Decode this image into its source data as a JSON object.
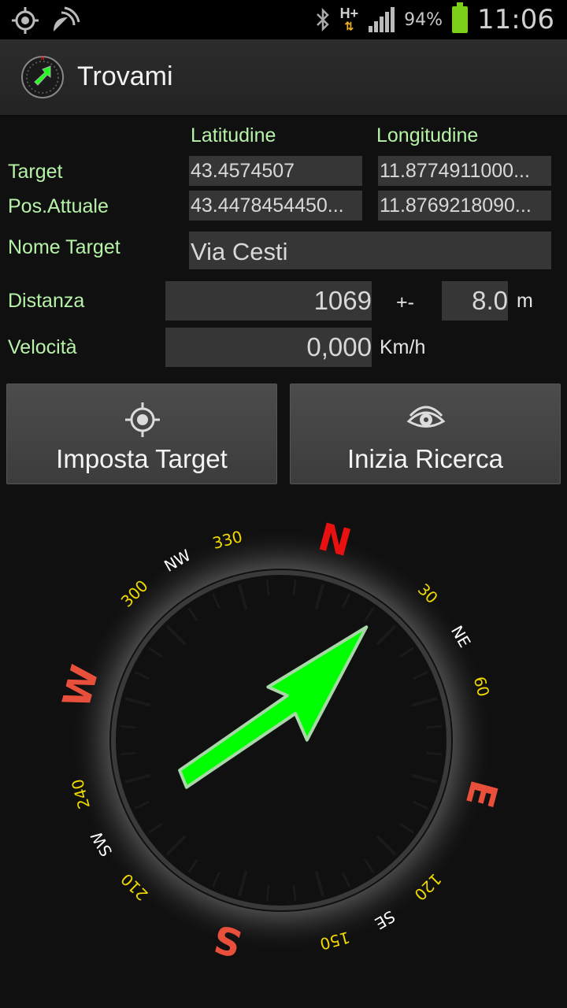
{
  "status_bar": {
    "battery_percent": "94%",
    "clock": "11:06",
    "network": "H+",
    "icons": [
      "gps-icon",
      "satellite-icon",
      "bluetooth-icon",
      "hplus-icon",
      "signal-icon",
      "battery-icon"
    ]
  },
  "app": {
    "title": "Trovami"
  },
  "columns": {
    "lat": "Latitudine",
    "lon": "Longitudine"
  },
  "target": {
    "label": "Target",
    "lat": "43.4574507",
    "lon": "11.8774911000..."
  },
  "current": {
    "label": "Pos.Attuale",
    "lat": "43.4478454450...",
    "lon": "11.8769218090..."
  },
  "name": {
    "label": "Nome Target",
    "value": "Via Cesti"
  },
  "distance": {
    "label": "Distanza",
    "value": "1069",
    "plusminus": "+-",
    "accuracy": "8.0",
    "unit": "m"
  },
  "speed": {
    "label": "Velocità",
    "value": "0,000",
    "unit": "Km/h"
  },
  "buttons": {
    "set_target": "Imposta Target",
    "start_search": "Inizia Ricerca"
  },
  "compass": {
    "rotation_deg": 15,
    "arrow_bearing_deg": 37,
    "labels": [
      {
        "text": "N",
        "angle": 0,
        "kind": "cardinal"
      },
      {
        "text": "30",
        "angle": 30,
        "kind": "deg"
      },
      {
        "text": "NE",
        "angle": 45,
        "kind": "inter"
      },
      {
        "text": "60",
        "angle": 60,
        "kind": "deg"
      },
      {
        "text": "E",
        "angle": 90,
        "kind": "cardinal"
      },
      {
        "text": "120",
        "angle": 120,
        "kind": "deg"
      },
      {
        "text": "SE",
        "angle": 135,
        "kind": "inter"
      },
      {
        "text": "150",
        "angle": 150,
        "kind": "deg"
      },
      {
        "text": "S",
        "angle": 180,
        "kind": "cardinal"
      },
      {
        "text": "210",
        "angle": 210,
        "kind": "deg"
      },
      {
        "text": "SW",
        "angle": 225,
        "kind": "inter"
      },
      {
        "text": "240",
        "angle": 240,
        "kind": "deg"
      },
      {
        "text": "W",
        "angle": 270,
        "kind": "cardinal"
      },
      {
        "text": "300",
        "angle": 300,
        "kind": "deg"
      },
      {
        "text": "NW",
        "angle": 315,
        "kind": "inter"
      },
      {
        "text": "330",
        "angle": 330,
        "kind": "deg"
      }
    ],
    "colors": {
      "cardinal_N": "#e81010",
      "cardinal": "#e8503c",
      "deg": "#f0d800",
      "inter": "#ffffff",
      "arrow": "#00ff00"
    }
  }
}
